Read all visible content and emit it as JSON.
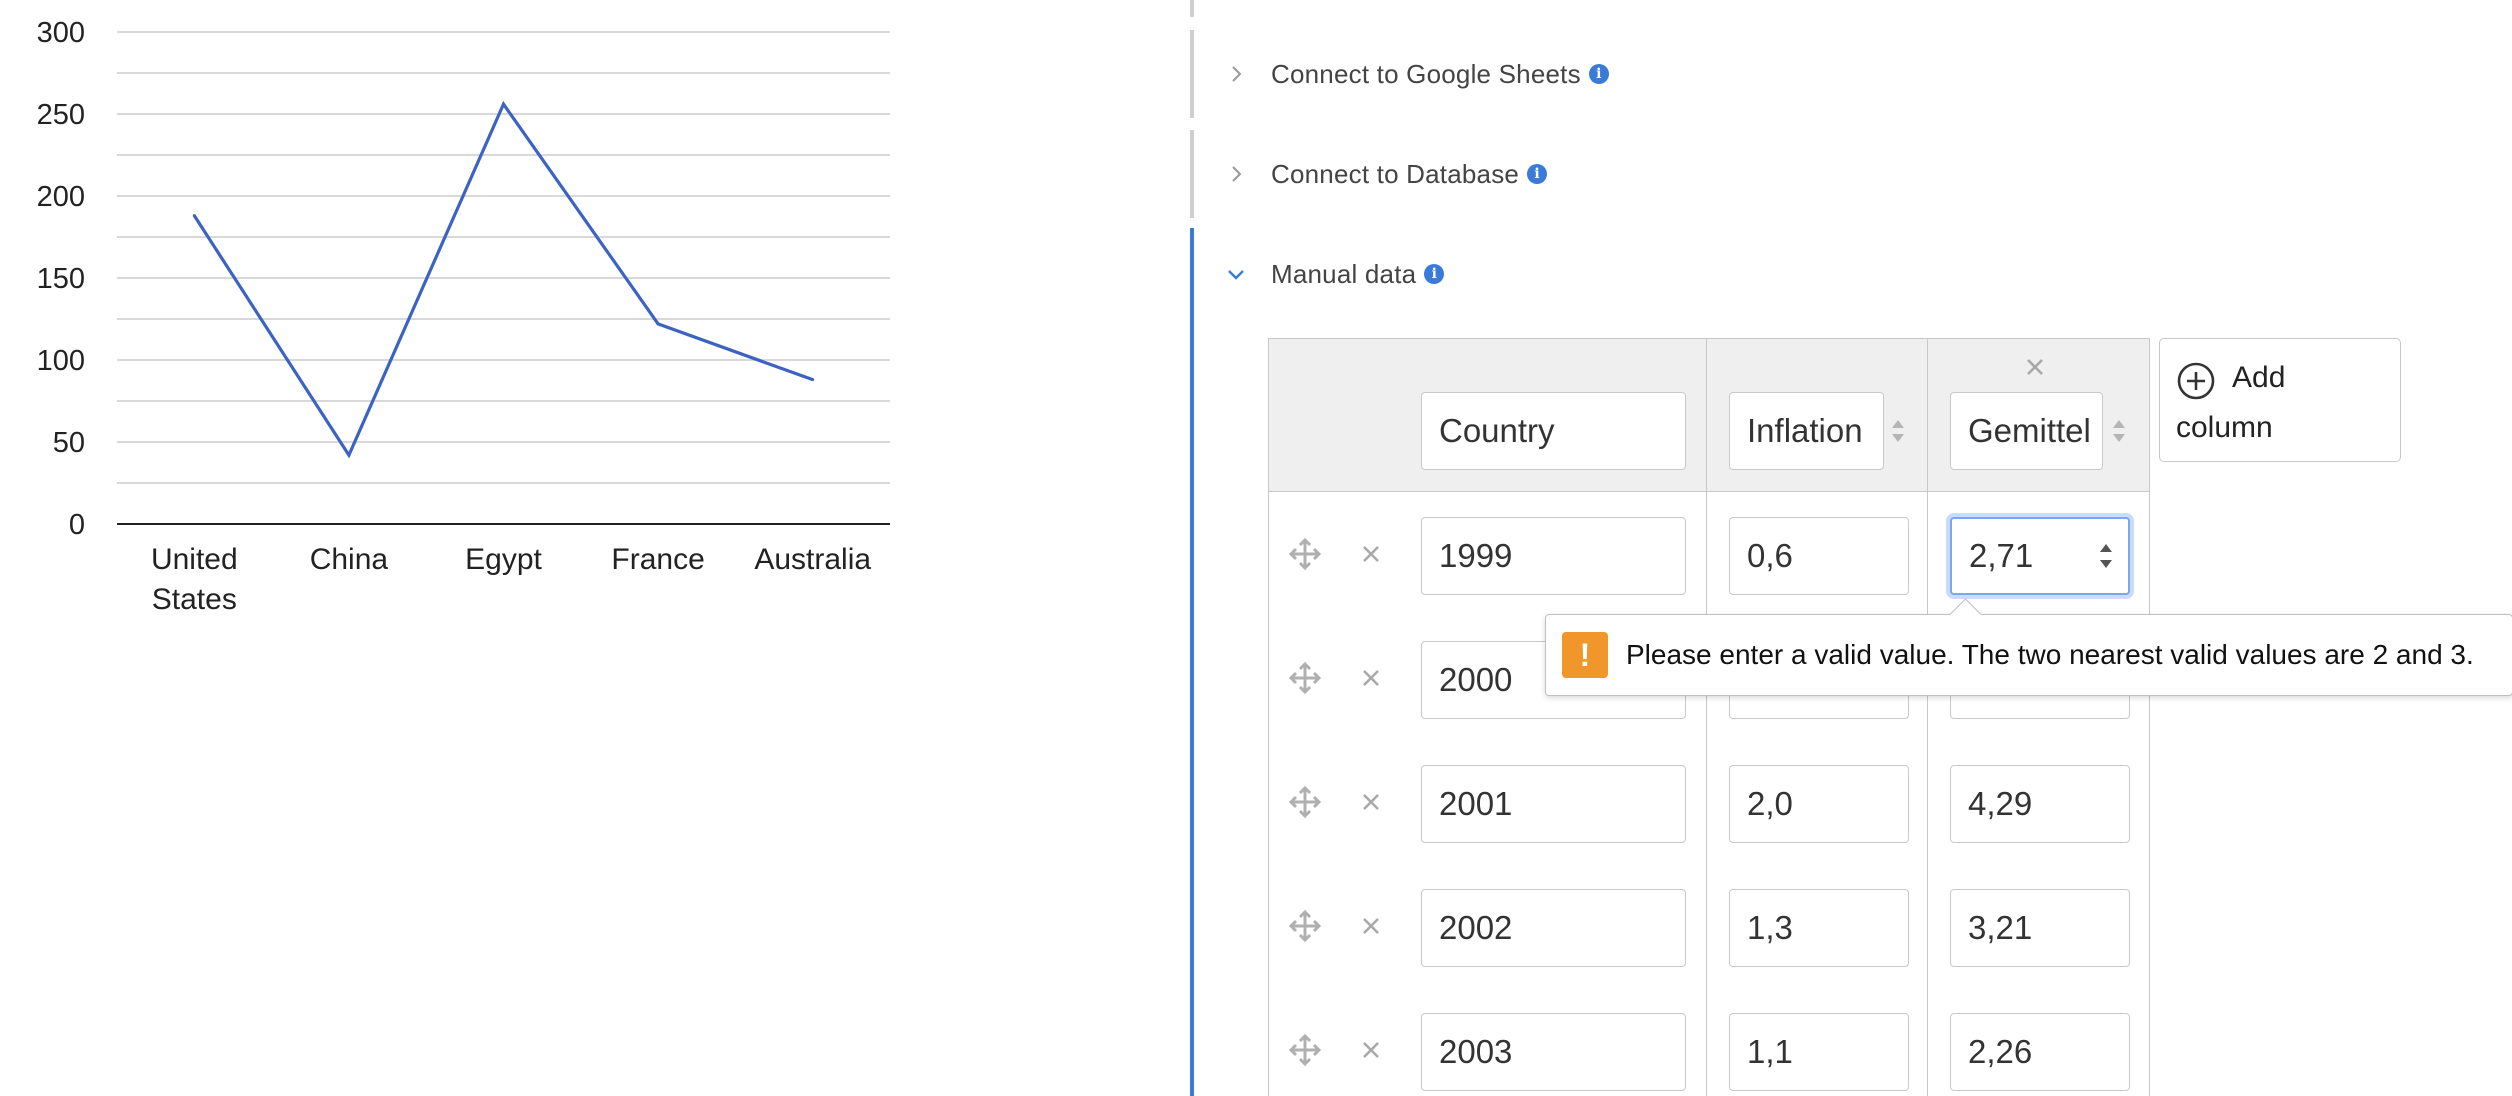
{
  "chart_data": {
    "type": "line",
    "categories": [
      "United States",
      "China",
      "Egypt",
      "France",
      "Australia"
    ],
    "category_lines": [
      [
        "United",
        "States"
      ],
      [
        "China"
      ],
      [
        "Egypt"
      ],
      [
        "France"
      ],
      [
        "Australia"
      ]
    ],
    "values": [
      188,
      42,
      256,
      122,
      88
    ],
    "y_ticks": [
      0,
      50,
      100,
      150,
      200,
      250,
      300
    ],
    "ylim": [
      0,
      300
    ],
    "grid": true,
    "line_color": "#3d63c2",
    "grid_color": "#cccccc"
  },
  "sections": {
    "google_sheets": {
      "title": "Connect to Google Sheets",
      "info_icon": "info-icon"
    },
    "database": {
      "title": "Connect to Database",
      "info_icon": "info-icon"
    },
    "manual": {
      "title": "Manual data",
      "info_icon": "info-icon"
    }
  },
  "table": {
    "columns": [
      {
        "header": "Country"
      },
      {
        "header": "Inflation"
      },
      {
        "header": "Gemittel"
      }
    ],
    "rows": [
      [
        "1999",
        "0,6",
        "2,71"
      ],
      [
        "2000",
        "",
        ""
      ],
      [
        "2001",
        "2,0",
        "4,29"
      ],
      [
        "2002",
        "1,3",
        "3,21"
      ],
      [
        "2003",
        "1,1",
        "2,26"
      ]
    ],
    "add_column": {
      "label_line1": "Add",
      "label_line2": "column"
    }
  },
  "tooltip": {
    "message": "Please enter a valid value. The two nearest valid values are 2 and 3."
  },
  "colors": {
    "accent": "#3a7ad9",
    "warning": "#f0962a"
  }
}
